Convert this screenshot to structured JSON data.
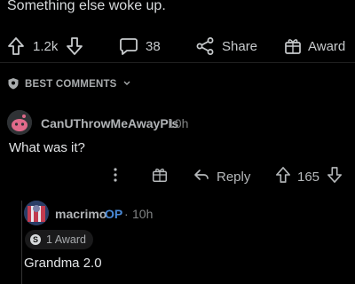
{
  "post": {
    "partial_text": "Something else woke up.",
    "upvotes": "1.2k",
    "comments": "38",
    "share_label": "Share",
    "award_label": "Award"
  },
  "sort": {
    "label": "BEST COMMENTS"
  },
  "comment1": {
    "username": "CanUThrowMeAwayPls",
    "time": "10h",
    "body": "What was it?",
    "reply_label": "Reply",
    "score": "165"
  },
  "comment2": {
    "username": "macrimo",
    "op_badge": "OP",
    "dot": "·",
    "time": "10h",
    "award_text": "1 Award",
    "award_coin": "S",
    "body": "Grandma 2.0"
  },
  "colors": {
    "background": "#000000",
    "text": "#d7dadc",
    "muted": "#818384",
    "op": "#4a8ad8"
  },
  "icons": [
    "upvote-icon",
    "downvote-icon",
    "comment-icon",
    "share-icon",
    "award-icon",
    "shield-icon",
    "chevron-down-icon",
    "more-icon",
    "reply-icon"
  ]
}
